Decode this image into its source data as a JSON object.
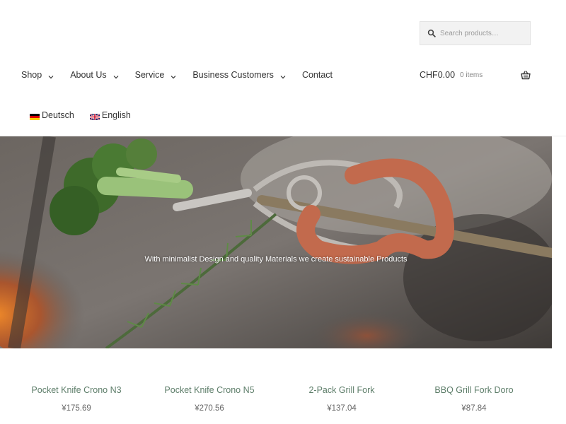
{
  "search": {
    "placeholder": "Search products…"
  },
  "nav": {
    "items": [
      {
        "label": "Shop",
        "has_dropdown": true
      },
      {
        "label": "About Us",
        "has_dropdown": true
      },
      {
        "label": "Service",
        "has_dropdown": true
      },
      {
        "label": "Business Customers",
        "has_dropdown": true
      },
      {
        "label": "Contact",
        "has_dropdown": false
      }
    ]
  },
  "cart": {
    "amount": "CHF0.00",
    "count": "0 items",
    "icon": "basket-icon"
  },
  "languages": [
    {
      "label": "Deutsch",
      "flag": "german-flag-icon"
    },
    {
      "label": "English",
      "flag": "uk-flag-icon"
    }
  ],
  "hero": {
    "tagline": "With minimalist Design and quality Materials we create sustainable Products"
  },
  "products": [
    {
      "title": "Pocket Knife Crono N3",
      "price": "¥175.69"
    },
    {
      "title": "Pocket Knife Crono N5",
      "price": "¥270.56"
    },
    {
      "title": "2-Pack Grill Fork",
      "price": "¥137.04"
    },
    {
      "title": "BBQ Grill Fork Doro",
      "price": "¥87.84"
    }
  ],
  "colors": {
    "product_title": "#5e7e6a",
    "search_bg": "#f2f2f2"
  }
}
